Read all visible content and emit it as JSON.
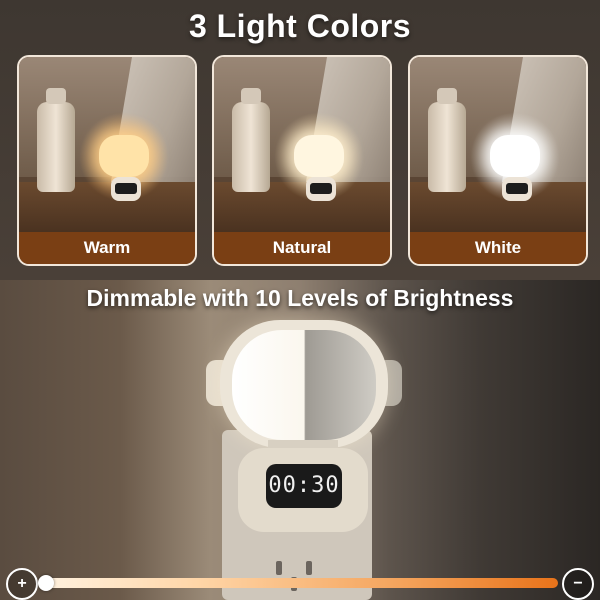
{
  "title": "3 Light Colors",
  "subtitle": "Dimmable with 10 Levels of Brightness",
  "cards": [
    {
      "label": "Warm"
    },
    {
      "label": "Natural"
    },
    {
      "label": "White"
    }
  ],
  "clock_display": "00:30",
  "brightness": {
    "levels": 10,
    "plus_icon": "bulb-plus-icon",
    "minus_icon": "bulb-minus-icon",
    "plus_glyph": "+",
    "minus_glyph": "−"
  },
  "colors": {
    "band": "#7a3f14",
    "track_start": "#fff2e0",
    "track_end": "#e8731a"
  }
}
